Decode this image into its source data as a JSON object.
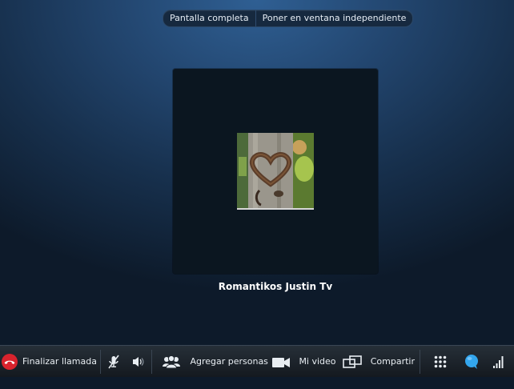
{
  "top_bar": {
    "fullscreen_label": "Pantalla completa",
    "popout_label": "Poner en ventana independiente"
  },
  "contact": {
    "name": "Romantikos Justin Tv"
  },
  "toolbar": {
    "end_call_label": "Finalizar llamada",
    "add_people_label": "Agregar personas",
    "my_video_label": "Mi video",
    "share_label": "Compartir"
  },
  "colors": {
    "end_call": "#d9232d",
    "chat_bubble": "#33a6ee",
    "background": "#22456e"
  },
  "icons": [
    "end-call-icon",
    "mic-muted-icon",
    "speaker-icon",
    "add-people-icon",
    "video-camera-icon",
    "share-screen-icon",
    "dialpad-icon",
    "chat-bubble-icon",
    "signal-strength-icon"
  ]
}
